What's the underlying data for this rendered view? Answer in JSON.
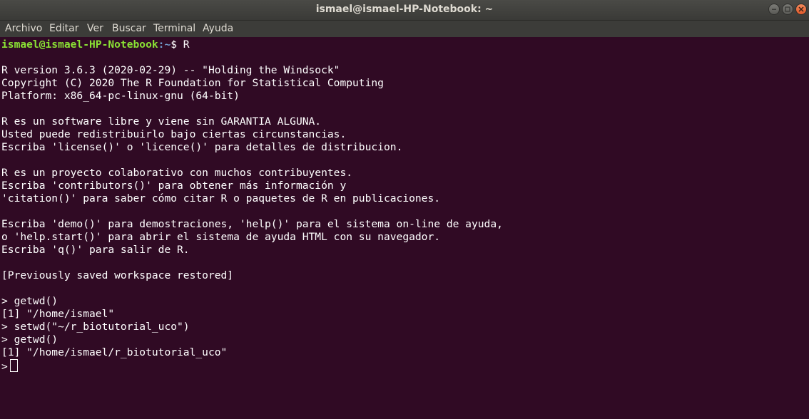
{
  "window": {
    "title": "ismael@ismael-HP-Notebook: ~"
  },
  "menu": [
    "Archivo",
    "Editar",
    "Ver",
    "Buscar",
    "Terminal",
    "Ayuda"
  ],
  "prompt": {
    "user_host": "ismael@ismael-HP-Notebook",
    "path": ":~",
    "symbol": "$ R"
  },
  "output_lines": [
    "R version 3.6.3 (2020-02-29) -- \"Holding the Windsock\"",
    "Copyright (C) 2020 The R Foundation for Statistical Computing",
    "Platform: x86_64-pc-linux-gnu (64-bit)",
    "",
    "R es un software libre y viene sin GARANTIA ALGUNA.",
    "Usted puede redistribuirlo bajo ciertas circunstancias.",
    "Escriba 'license()' o 'licence()' para detalles de distribucion.",
    "",
    "R es un proyecto colaborativo con muchos contribuyentes.",
    "Escriba 'contributors()' para obtener más información y",
    "'citation()' para saber cómo citar R o paquetes de R en publicaciones.",
    "",
    "Escriba 'demo()' para demostraciones, 'help()' para el sistema on-line de ayuda,",
    "o 'help.start()' para abrir el sistema de ayuda HTML con su navegador.",
    "Escriba 'q()' para salir de R.",
    "",
    "[Previously saved workspace restored]",
    "",
    "> getwd()",
    "[1] \"/home/ismael\"",
    "> setwd(\"~/r_biotutorial_uco\")",
    "> getwd()",
    "[1] \"/home/ismael/r_biotutorial_uco\""
  ],
  "input_prompt": ">"
}
